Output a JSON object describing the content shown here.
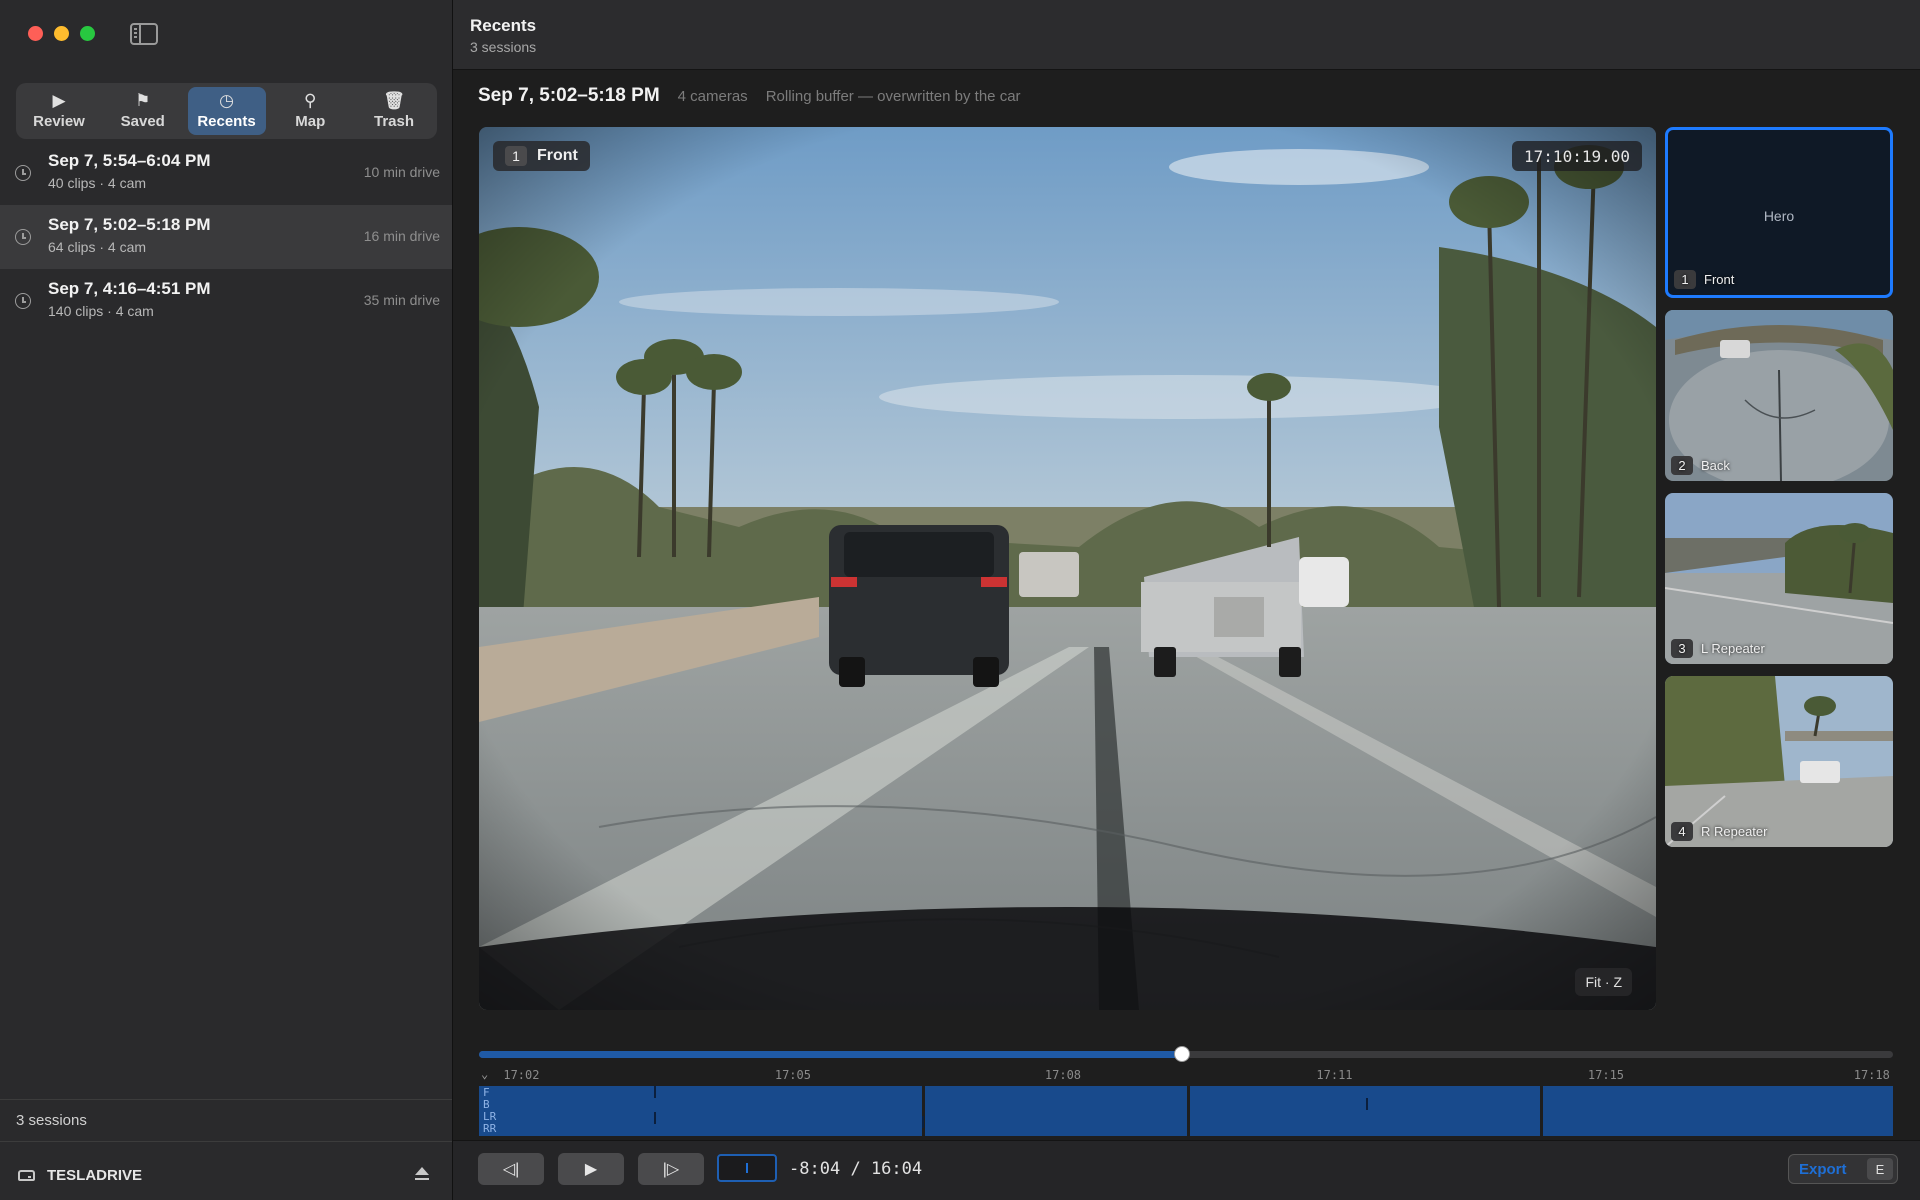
{
  "window": {
    "traffic_lights": [
      "close",
      "minimize",
      "zoom"
    ]
  },
  "sidebar": {
    "tabs": [
      {
        "label": "Review",
        "icon": "play-icon"
      },
      {
        "label": "Saved",
        "icon": "flag-icon"
      },
      {
        "label": "Recents",
        "icon": "clock-icon",
        "active": true
      },
      {
        "label": "Map",
        "icon": "map-pin-icon"
      },
      {
        "label": "Trash",
        "icon": "trash-icon"
      }
    ],
    "sessions": [
      {
        "title": "Sep 7, 5:54–6:04 PM",
        "sub": "40 clips · 4 cam",
        "duration": "10 min drive"
      },
      {
        "title": "Sep 7, 5:02–5:18 PM",
        "sub": "64 clips · 4 cam",
        "duration": "16 min drive",
        "selected": true
      },
      {
        "title": "Sep 7, 4:16–4:51 PM",
        "sub": "140 clips · 4 cam",
        "duration": "35 min drive"
      }
    ],
    "footer_count": "3 sessions",
    "drive_name": "TESLADRIVE"
  },
  "header": {
    "title": "Recents",
    "subtitle": "3 sessions"
  },
  "session": {
    "title": "Sep 7, 5:02–5:18 PM",
    "cameras": "4 cameras",
    "note": "Rolling buffer — overwritten by the car"
  },
  "hero": {
    "camera_num": "1",
    "camera_name": "Front",
    "timecode": "17:10:19.00",
    "fit_label": "Fit · Z"
  },
  "thumbnails": [
    {
      "num": "1",
      "name": "Front",
      "placeholder": "Hero"
    },
    {
      "num": "2",
      "name": "Back"
    },
    {
      "num": "3",
      "name": "L Repeater"
    },
    {
      "num": "4",
      "name": "R Repeater"
    }
  ],
  "timeline": {
    "progress": 0.497,
    "ticks": [
      "17:02",
      "17:05",
      "17:08",
      "17:11",
      "17:15",
      "17:18"
    ],
    "lanes": [
      "F",
      "B",
      "LR",
      "RR"
    ]
  },
  "controls": {
    "prev_icon": "step-back-icon",
    "play_icon": "play-icon",
    "next_icon": "step-forward-icon",
    "time_remaining": "-8:04",
    "separator": "/",
    "total_time": "16:04",
    "export_label": "Export",
    "export_key": "E"
  },
  "colors": {
    "accent": "#1e7bff",
    "timeline_fill": "#184a8c",
    "active_tab": "#3f5f85"
  }
}
